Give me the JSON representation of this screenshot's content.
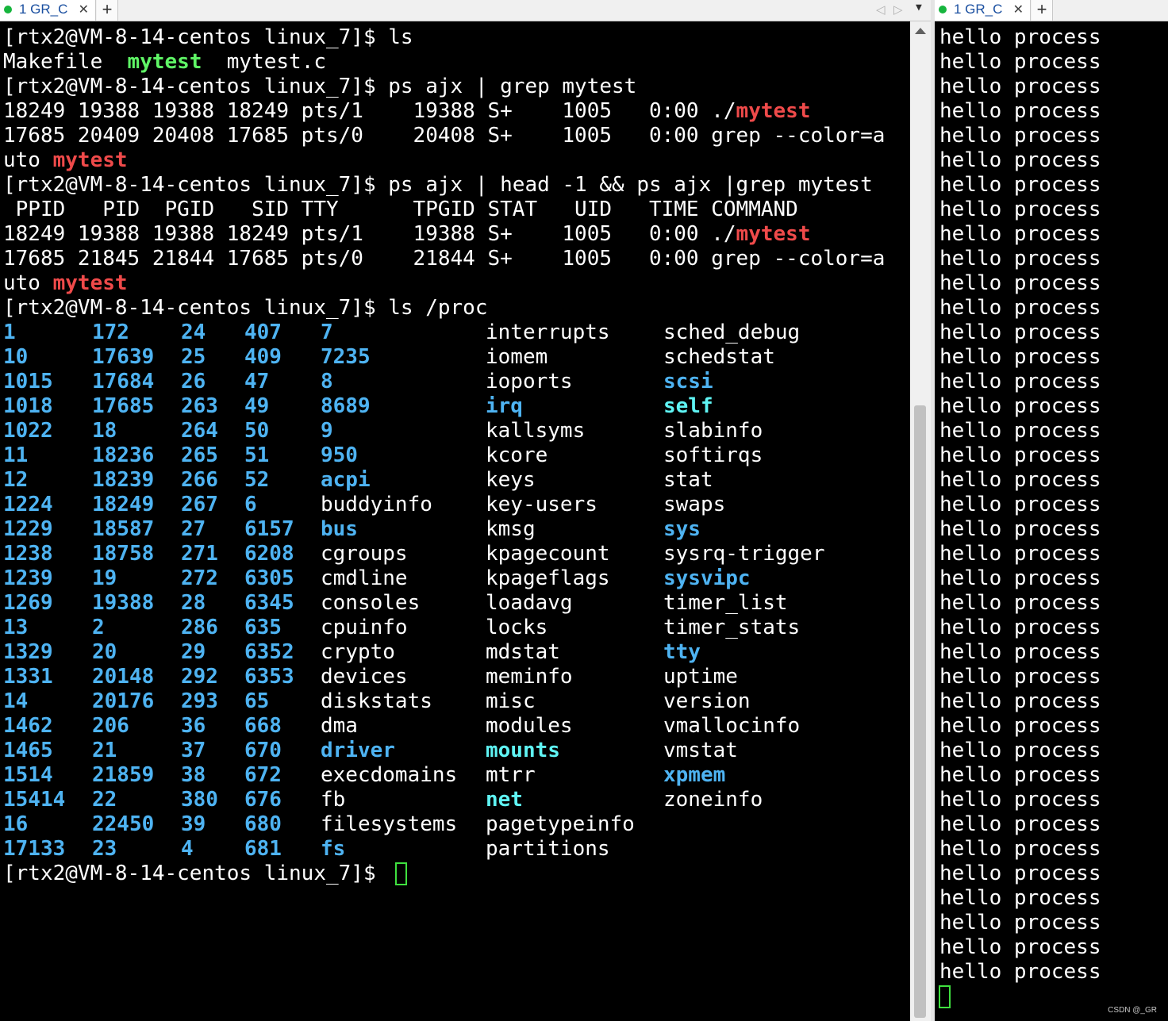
{
  "tabs": {
    "left": {
      "title": "1 GR_C",
      "close": "✕",
      "new": "+"
    },
    "right": {
      "title": "1 GR_C",
      "close": "✕",
      "new": "+"
    },
    "nav_prev": "◁",
    "nav_next": "▷",
    "dropdown": "▼"
  },
  "terminal_left": {
    "lines": [
      [
        {
          "t": "[rtx2@VM-8-14-centos linux_7]$ ls",
          "c": "white"
        }
      ],
      [
        {
          "t": "Makefile  ",
          "c": "white"
        },
        {
          "t": "mytest",
          "c": "green"
        },
        {
          "t": "  mytest.c",
          "c": "white"
        }
      ],
      [
        {
          "t": "[rtx2@VM-8-14-centos linux_7]$ ps ajx | grep mytest",
          "c": "white"
        }
      ],
      [
        {
          "t": "18249 19388 19388 18249 pts/1    19388 S+    1005   0:00 ./",
          "c": "white"
        },
        {
          "t": "mytest",
          "c": "red"
        }
      ],
      [
        {
          "t": "17685 20409 20408 17685 pts/0    20408 S+    1005   0:00 grep --color=a",
          "c": "white"
        }
      ],
      [
        {
          "t": "uto ",
          "c": "white"
        },
        {
          "t": "mytest",
          "c": "red"
        }
      ],
      [
        {
          "t": "[rtx2@VM-8-14-centos linux_7]$ ps ajx | head -1 && ps ajx |grep mytest",
          "c": "white"
        }
      ],
      [
        {
          "t": " PPID   PID  PGID   SID TTY      TPGID STAT   UID   TIME COMMAND",
          "c": "white"
        }
      ],
      [
        {
          "t": "18249 19388 19388 18249 pts/1    19388 S+    1005   0:00 ./",
          "c": "white"
        },
        {
          "t": "mytest",
          "c": "red"
        }
      ],
      [
        {
          "t": "17685 21845 21844 17685 pts/0    21844 S+    1005   0:00 grep --color=a",
          "c": "white"
        }
      ],
      [
        {
          "t": "uto ",
          "c": "white"
        },
        {
          "t": "mytest",
          "c": "red"
        }
      ],
      [
        {
          "t": "[rtx2@VM-8-14-centos linux_7]$ ls /proc",
          "c": "white"
        }
      ]
    ],
    "proc_columns": [
      [
        {
          "t": "1",
          "c": "blue"
        },
        {
          "t": "10",
          "c": "blue"
        },
        {
          "t": "1015",
          "c": "blue"
        },
        {
          "t": "1018",
          "c": "blue"
        },
        {
          "t": "1022",
          "c": "blue"
        },
        {
          "t": "11",
          "c": "blue"
        },
        {
          "t": "12",
          "c": "blue"
        },
        {
          "t": "1224",
          "c": "blue"
        },
        {
          "t": "1229",
          "c": "blue"
        },
        {
          "t": "1238",
          "c": "blue"
        },
        {
          "t": "1239",
          "c": "blue"
        },
        {
          "t": "1269",
          "c": "blue"
        },
        {
          "t": "13",
          "c": "blue"
        },
        {
          "t": "1329",
          "c": "blue"
        },
        {
          "t": "1331",
          "c": "blue"
        },
        {
          "t": "14",
          "c": "blue"
        },
        {
          "t": "1462",
          "c": "blue"
        },
        {
          "t": "1465",
          "c": "blue"
        },
        {
          "t": "1514",
          "c": "blue"
        },
        {
          "t": "15414",
          "c": "blue"
        },
        {
          "t": "16",
          "c": "blue"
        },
        {
          "t": "17133",
          "c": "blue"
        }
      ],
      [
        {
          "t": "172",
          "c": "blue"
        },
        {
          "t": "17639",
          "c": "blue"
        },
        {
          "t": "17684",
          "c": "blue"
        },
        {
          "t": "17685",
          "c": "blue"
        },
        {
          "t": "18",
          "c": "blue"
        },
        {
          "t": "18236",
          "c": "blue"
        },
        {
          "t": "18239",
          "c": "blue"
        },
        {
          "t": "18249",
          "c": "blue"
        },
        {
          "t": "18587",
          "c": "blue"
        },
        {
          "t": "18758",
          "c": "blue"
        },
        {
          "t": "19",
          "c": "blue"
        },
        {
          "t": "19388",
          "c": "blue"
        },
        {
          "t": "2",
          "c": "blue"
        },
        {
          "t": "20",
          "c": "blue"
        },
        {
          "t": "20148",
          "c": "blue"
        },
        {
          "t": "20176",
          "c": "blue"
        },
        {
          "t": "206",
          "c": "blue"
        },
        {
          "t": "21",
          "c": "blue"
        },
        {
          "t": "21859",
          "c": "blue"
        },
        {
          "t": "22",
          "c": "blue"
        },
        {
          "t": "22450",
          "c": "blue"
        },
        {
          "t": "23",
          "c": "blue"
        }
      ],
      [
        {
          "t": "24",
          "c": "blue"
        },
        {
          "t": "25",
          "c": "blue"
        },
        {
          "t": "26",
          "c": "blue"
        },
        {
          "t": "263",
          "c": "blue"
        },
        {
          "t": "264",
          "c": "blue"
        },
        {
          "t": "265",
          "c": "blue"
        },
        {
          "t": "266",
          "c": "blue"
        },
        {
          "t": "267",
          "c": "blue"
        },
        {
          "t": "27",
          "c": "blue"
        },
        {
          "t": "271",
          "c": "blue"
        },
        {
          "t": "272",
          "c": "blue"
        },
        {
          "t": "28",
          "c": "blue"
        },
        {
          "t": "286",
          "c": "blue"
        },
        {
          "t": "29",
          "c": "blue"
        },
        {
          "t": "292",
          "c": "blue"
        },
        {
          "t": "293",
          "c": "blue"
        },
        {
          "t": "36",
          "c": "blue"
        },
        {
          "t": "37",
          "c": "blue"
        },
        {
          "t": "38",
          "c": "blue"
        },
        {
          "t": "380",
          "c": "blue"
        },
        {
          "t": "39",
          "c": "blue"
        },
        {
          "t": "4",
          "c": "blue"
        }
      ],
      [
        {
          "t": "407",
          "c": "blue"
        },
        {
          "t": "409",
          "c": "blue"
        },
        {
          "t": "47",
          "c": "blue"
        },
        {
          "t": "49",
          "c": "blue"
        },
        {
          "t": "50",
          "c": "blue"
        },
        {
          "t": "51",
          "c": "blue"
        },
        {
          "t": "52",
          "c": "blue"
        },
        {
          "t": "6",
          "c": "blue"
        },
        {
          "t": "6157",
          "c": "blue"
        },
        {
          "t": "6208",
          "c": "blue"
        },
        {
          "t": "6305",
          "c": "blue"
        },
        {
          "t": "6345",
          "c": "blue"
        },
        {
          "t": "635",
          "c": "blue"
        },
        {
          "t": "6352",
          "c": "blue"
        },
        {
          "t": "6353",
          "c": "blue"
        },
        {
          "t": "65",
          "c": "blue"
        },
        {
          "t": "668",
          "c": "blue"
        },
        {
          "t": "670",
          "c": "blue"
        },
        {
          "t": "672",
          "c": "blue"
        },
        {
          "t": "676",
          "c": "blue"
        },
        {
          "t": "680",
          "c": "blue"
        },
        {
          "t": "681",
          "c": "blue"
        }
      ],
      [
        {
          "t": "7",
          "c": "blue"
        },
        {
          "t": "7235",
          "c": "blue"
        },
        {
          "t": "8",
          "c": "blue"
        },
        {
          "t": "8689",
          "c": "blue"
        },
        {
          "t": "9",
          "c": "blue"
        },
        {
          "t": "950",
          "c": "blue"
        },
        {
          "t": "acpi",
          "c": "blue"
        },
        {
          "t": "buddyinfo",
          "c": "white"
        },
        {
          "t": "bus",
          "c": "blue"
        },
        {
          "t": "cgroups",
          "c": "white"
        },
        {
          "t": "cmdline",
          "c": "white"
        },
        {
          "t": "consoles",
          "c": "white"
        },
        {
          "t": "cpuinfo",
          "c": "white"
        },
        {
          "t": "crypto",
          "c": "white"
        },
        {
          "t": "devices",
          "c": "white"
        },
        {
          "t": "diskstats",
          "c": "white"
        },
        {
          "t": "dma",
          "c": "white"
        },
        {
          "t": "driver",
          "c": "blue"
        },
        {
          "t": "execdomains",
          "c": "white"
        },
        {
          "t": "fb",
          "c": "white"
        },
        {
          "t": "filesystems",
          "c": "white"
        },
        {
          "t": "fs",
          "c": "blue"
        }
      ],
      [
        {
          "t": "interrupts",
          "c": "white"
        },
        {
          "t": "iomem",
          "c": "white"
        },
        {
          "t": "ioports",
          "c": "white"
        },
        {
          "t": "irq",
          "c": "blue"
        },
        {
          "t": "kallsyms",
          "c": "white"
        },
        {
          "t": "kcore",
          "c": "white"
        },
        {
          "t": "keys",
          "c": "white"
        },
        {
          "t": "key-users",
          "c": "white"
        },
        {
          "t": "kmsg",
          "c": "white"
        },
        {
          "t": "kpagecount",
          "c": "white"
        },
        {
          "t": "kpageflags",
          "c": "white"
        },
        {
          "t": "loadavg",
          "c": "white"
        },
        {
          "t": "locks",
          "c": "white"
        },
        {
          "t": "mdstat",
          "c": "white"
        },
        {
          "t": "meminfo",
          "c": "white"
        },
        {
          "t": "misc",
          "c": "white"
        },
        {
          "t": "modules",
          "c": "white"
        },
        {
          "t": "mounts",
          "c": "cyan"
        },
        {
          "t": "mtrr",
          "c": "white"
        },
        {
          "t": "net",
          "c": "cyan"
        },
        {
          "t": "pagetypeinfo",
          "c": "white"
        },
        {
          "t": "partitions",
          "c": "white"
        }
      ],
      [
        {
          "t": "sched_debug",
          "c": "white"
        },
        {
          "t": "schedstat",
          "c": "white"
        },
        {
          "t": "scsi",
          "c": "blue"
        },
        {
          "t": "self",
          "c": "cyan"
        },
        {
          "t": "slabinfo",
          "c": "white"
        },
        {
          "t": "softirqs",
          "c": "white"
        },
        {
          "t": "stat",
          "c": "white"
        },
        {
          "t": "swaps",
          "c": "white"
        },
        {
          "t": "sys",
          "c": "blue"
        },
        {
          "t": "sysrq-trigger",
          "c": "white"
        },
        {
          "t": "sysvipc",
          "c": "blue"
        },
        {
          "t": "timer_list",
          "c": "white"
        },
        {
          "t": "timer_stats",
          "c": "white"
        },
        {
          "t": "tty",
          "c": "blue"
        },
        {
          "t": "uptime",
          "c": "white"
        },
        {
          "t": "version",
          "c": "white"
        },
        {
          "t": "vmallocinfo",
          "c": "white"
        },
        {
          "t": "vmstat",
          "c": "white"
        },
        {
          "t": "xpmem",
          "c": "blue"
        },
        {
          "t": "zoneinfo",
          "c": "white"
        }
      ]
    ],
    "prompt": "[rtx2@VM-8-14-centos linux_7]$ "
  },
  "terminal_right": {
    "line_text": "hello process",
    "line_count": 39
  },
  "watermark": "CSDN @_GR",
  "colors": {
    "red": "#ef4a4a",
    "green": "#5ff566",
    "blue": "#4eb3f2",
    "cyan": "#5ff4f4",
    "cursor": "#3fe03f",
    "tab_dot": "#16b53d"
  }
}
